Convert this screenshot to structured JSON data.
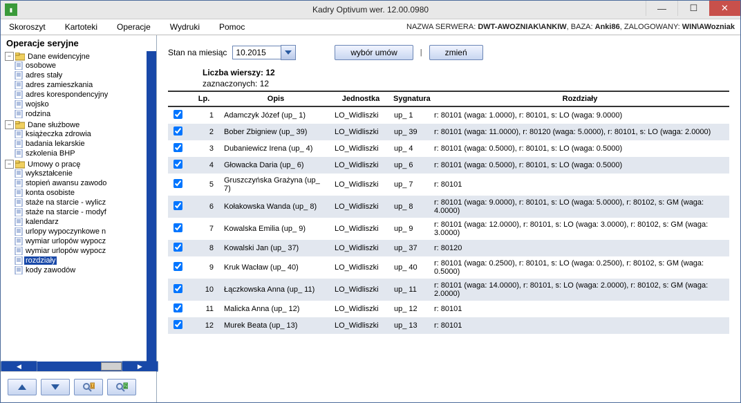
{
  "window": {
    "title": "Kadry Optivum wer. 12.00.0980"
  },
  "menu": {
    "items": [
      "Skoroszyt",
      "Kartoteki",
      "Operacje",
      "Wydruki",
      "Pomoc"
    ],
    "status": {
      "server_lbl": "NAZWA SERWERA:",
      "server_val": "DWT-AWOZNIAK\\ANKIW",
      "db_lbl": "BAZA:",
      "db_val": "Anki86",
      "user_lbl": "ZALOGOWANY:",
      "user_val": "WIN\\AWozniak"
    }
  },
  "sidebar": {
    "title": "Operacje seryjne",
    "groups": [
      {
        "label": "Dane ewidencyjne",
        "children": [
          "osobowe",
          "adres stały",
          "adres zamieszkania",
          "adres korespondencyjny",
          "wojsko",
          "rodzina"
        ]
      },
      {
        "label": "Dane służbowe",
        "children": [
          "książeczka zdrowia",
          "badania lekarskie",
          "szkolenia BHP"
        ]
      },
      {
        "label": "Umowy o pracę",
        "children": [
          "wykształcenie",
          "stopień awansu zawodo",
          "konta osobiste",
          "staże na starcie - wylicz",
          "staże na starcie - modyf",
          "kalendarz",
          "urlopy wypoczynkowe n",
          "wymiar urlopów wypocz",
          "wymiar urlopów wypocz",
          "rozdziały",
          "kody zawodów"
        ],
        "selected_index": 9
      }
    ]
  },
  "filter": {
    "label": "Stan na miesiąc",
    "value": "10.2015",
    "btn_select": "wybór umów",
    "sep": "|",
    "btn_change": "zmień"
  },
  "counts": {
    "rows_lbl": "Liczba wierszy: 12",
    "sel_lbl": "zaznaczonych: 12"
  },
  "table": {
    "headers": {
      "lp": "Lp.",
      "opis": "Opis",
      "jednostka": "Jednostka",
      "sygnatura": "Sygnatura",
      "rozdzialy": "Rozdziały"
    },
    "rows": [
      {
        "lp": "1",
        "opis": "Adamczyk Józef (up_ 1)",
        "jed": "LO_Widliszki",
        "syg": "up_ 1",
        "roz": "r: 80101 (waga: 1.0000), r: 80101, s: LO (waga: 9.0000)"
      },
      {
        "lp": "2",
        "opis": "Bober Zbigniew (up_ 39)",
        "jed": "LO_Widliszki",
        "syg": "up_ 39",
        "roz": "r: 80101 (waga: 11.0000), r: 80120 (waga: 5.0000), r: 80101, s: LO (waga: 2.0000)"
      },
      {
        "lp": "3",
        "opis": "Dubaniewicz Irena (up_ 4)",
        "jed": "LO_Widliszki",
        "syg": "up_ 4",
        "roz": "r: 80101 (waga: 0.5000), r: 80101, s: LO (waga: 0.5000)"
      },
      {
        "lp": "4",
        "opis": "Głowacka Daria (up_ 6)",
        "jed": "LO_Widliszki",
        "syg": "up_ 6",
        "roz": "r: 80101 (waga: 0.5000), r: 80101, s: LO (waga: 0.5000)"
      },
      {
        "lp": "5",
        "opis": "Gruszczyńska Grażyna (up_ 7)",
        "jed": "LO_Widliszki",
        "syg": "up_ 7",
        "roz": "r: 80101"
      },
      {
        "lp": "6",
        "opis": "Kołakowska Wanda (up_ 8)",
        "jed": "LO_Widliszki",
        "syg": "up_ 8",
        "roz": "r: 80101 (waga: 9.0000), r: 80101, s: LO (waga: 5.0000), r: 80102, s: GM (waga: 4.0000)"
      },
      {
        "lp": "7",
        "opis": "Kowalska Emilia (up_ 9)",
        "jed": "LO_Widliszki",
        "syg": "up_ 9",
        "roz": "r: 80101 (waga: 12.0000), r: 80101, s: LO (waga: 3.0000), r: 80102, s: GM (waga: 3.0000)"
      },
      {
        "lp": "8",
        "opis": "Kowalski Jan (up_ 37)",
        "jed": "LO_Widliszki",
        "syg": "up_ 37",
        "roz": "r: 80120"
      },
      {
        "lp": "9",
        "opis": "Kruk Wacław (up_ 40)",
        "jed": "LO_Widliszki",
        "syg": "up_ 40",
        "roz": "r: 80101 (waga: 0.2500), r: 80101, s: LO (waga: 0.2500), r: 80102, s: GM (waga: 0.5000)"
      },
      {
        "lp": "10",
        "opis": "Łączkowska Anna (up_ 11)",
        "jed": "LO_Widliszki",
        "syg": "up_ 11",
        "roz": "r: 80101 (waga: 14.0000), r: 80101, s: LO (waga: 2.0000), r: 80102, s: GM (waga: 2.0000)"
      },
      {
        "lp": "11",
        "opis": "Malicka Anna (up_ 12)",
        "jed": "LO_Widliszki",
        "syg": "up_ 12",
        "roz": "r: 80101"
      },
      {
        "lp": "12",
        "opis": "Murek Beata (up_ 13)",
        "jed": "LO_Widliszki",
        "syg": "up_ 13",
        "roz": "r: 80101"
      }
    ]
  }
}
